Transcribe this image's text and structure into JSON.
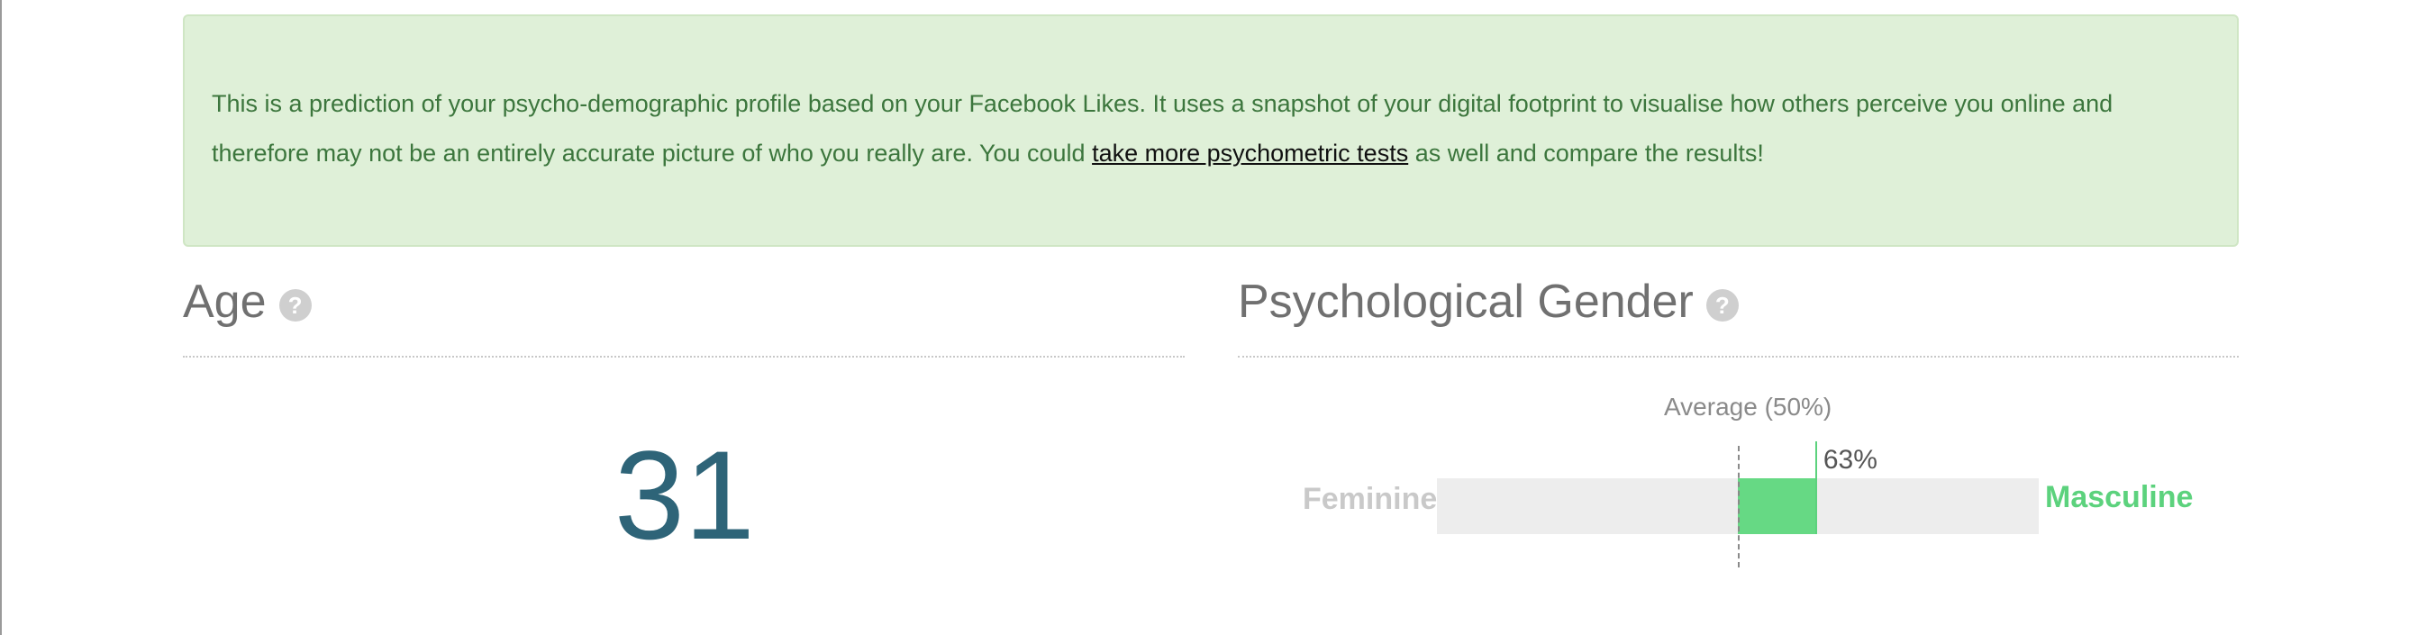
{
  "notice": {
    "text_before_link": "This is a prediction of your psycho-demographic profile based on your Facebook Likes. It uses a snapshot of your digital footprint to visualise how others perceive you online and therefore may not be an entirely accurate picture of who you really are. You could ",
    "link_text": "take more psychometric tests",
    "text_after_link": " as well and compare the results!"
  },
  "age": {
    "title": "Age",
    "help_icon": "?",
    "value": "31"
  },
  "gender": {
    "title": "Psychological Gender",
    "help_icon": "?",
    "average_label": "Average (50%)",
    "left_label": "Feminine",
    "right_label": "Masculine",
    "value_label": "63%",
    "value_fraction": 0.63,
    "average_fraction": 0.5,
    "colors": {
      "fill": "#66d984",
      "track": "#ededed",
      "masculine_label": "#5cd27d",
      "feminine_label": "#c9c9c9"
    }
  },
  "colors": {
    "alert_background": "#dff0d8",
    "alert_text": "#3c763d",
    "age_value": "#2e6478"
  },
  "icons": {
    "help": "question-circle-icon"
  }
}
